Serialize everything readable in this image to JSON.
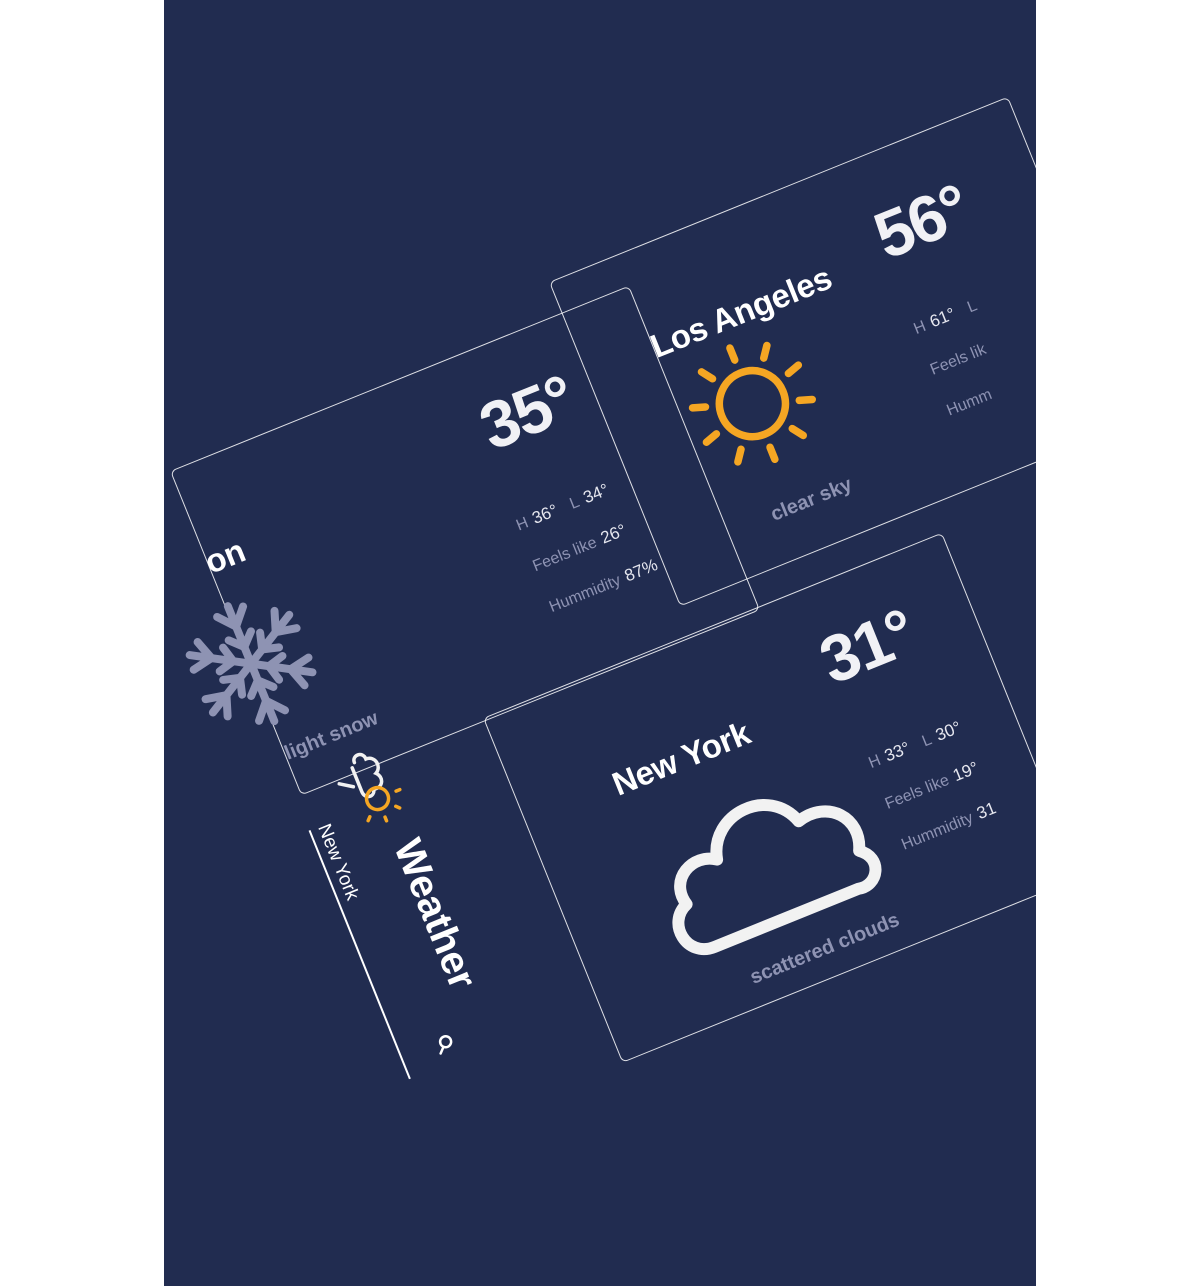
{
  "app": {
    "title": "Weather",
    "search_value": "New York",
    "icon_colors": {
      "cloud": "#f2f2f2",
      "sun": "#f5a623"
    }
  },
  "colors": {
    "background": "#212c50",
    "text": "#ffffff",
    "muted": "#8e93b3",
    "sun": "#f5a623",
    "snow": "#8e93b3",
    "cloud": "#f2f2f2"
  },
  "cards": [
    {
      "city": "on",
      "temp": "35°",
      "high_label": "H",
      "high": "36°",
      "low_label": "L",
      "low": "34°",
      "feels_label": "Feels like",
      "feels": "26°",
      "humidity_label": "Hummidity",
      "humidity": "87%",
      "description": "light snow",
      "icon": "snowflake-icon"
    },
    {
      "city": "Los Angeles",
      "temp": "56°",
      "high_label": "H",
      "high": "61°",
      "low_label": "L",
      "low": "",
      "feels_label": "Feels lik",
      "feels": "",
      "humidity_label": "Humm",
      "humidity": "",
      "description": "clear sky",
      "icon": "sun-icon"
    },
    {
      "city": "New York",
      "temp": "31°",
      "high_label": "H",
      "high": "33°",
      "low_label": "L",
      "low": "30°",
      "feels_label": "Feels like",
      "feels": "19°",
      "humidity_label": "Hummidity",
      "humidity": "31",
      "description": "scattered clouds",
      "icon": "cloud-icon"
    }
  ]
}
